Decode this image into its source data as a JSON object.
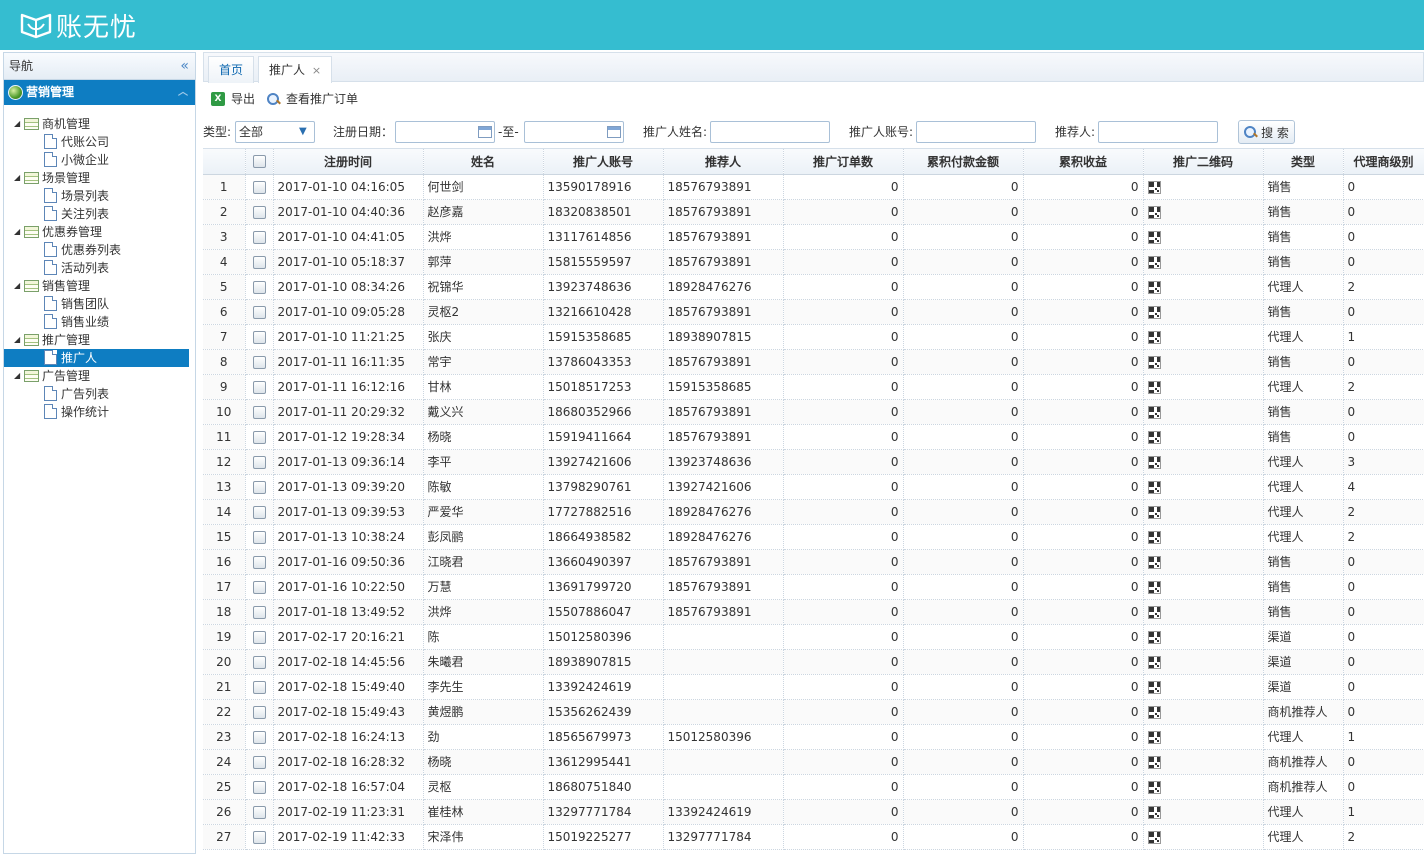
{
  "header": {
    "logo_text": "账无忧",
    "brand_color": "#35bdd0"
  },
  "nav": {
    "title": "导航",
    "collapse_icon": "«",
    "accordion_title": "营销管理",
    "accordion_icon": "︿",
    "selected_color": "#0e7dc2",
    "tree": [
      {
        "label": "商机管理",
        "children": [
          "代账公司",
          "小微企业"
        ]
      },
      {
        "label": "场景管理",
        "children": [
          "场景列表",
          "关注列表"
        ]
      },
      {
        "label": "优惠券管理",
        "children": [
          "优惠券列表",
          "活动列表"
        ]
      },
      {
        "label": "销售管理",
        "children": [
          "销售团队",
          "销售业绩"
        ]
      },
      {
        "label": "推广管理",
        "children": [
          "推广人"
        ]
      },
      {
        "label": "广告管理",
        "children": [
          "广告列表",
          "操作统计"
        ]
      }
    ],
    "selected_item": "推广人"
  },
  "tabs": [
    {
      "label": "首页"
    },
    {
      "label": "推广人",
      "close": "×"
    }
  ],
  "toolbar": {
    "export_label": "导出",
    "view_orders_label": "查看推广订单"
  },
  "filter": {
    "type_label": "类型:",
    "type_value": "全部",
    "date_label": "注册日期：",
    "date_from": "",
    "date_sep": "-至-",
    "date_to": "",
    "name_label": "推广人姓名:",
    "name_value": "",
    "account_label": "推广人账号:",
    "account_value": "",
    "referrer_label": "推荐人:",
    "referrer_value": "",
    "search_label": "搜 索"
  },
  "table": {
    "columns": [
      "",
      "",
      "注册时间",
      "姓名",
      "推广人账号",
      "推荐人",
      "推广订单数",
      "累积付款金额",
      "累积收益",
      "推广二维码",
      "类型",
      "代理商级别"
    ],
    "rows": [
      [
        "1",
        "2017-01-10 04:16:05",
        "何世剑",
        "13590178916",
        "18576793891",
        "0",
        "0",
        "0",
        "销售",
        "0"
      ],
      [
        "2",
        "2017-01-10 04:40:36",
        "赵彦嘉",
        "18320838501",
        "18576793891",
        "0",
        "0",
        "0",
        "销售",
        "0"
      ],
      [
        "3",
        "2017-01-10 04:41:05",
        "洪烨",
        "13117614856",
        "18576793891",
        "0",
        "0",
        "0",
        "销售",
        "0"
      ],
      [
        "4",
        "2017-01-10 05:18:37",
        "郭萍",
        "15815559597",
        "18576793891",
        "0",
        "0",
        "0",
        "销售",
        "0"
      ],
      [
        "5",
        "2017-01-10 08:34:26",
        "祝锦华",
        "13923748636",
        "18928476276",
        "0",
        "0",
        "0",
        "代理人",
        "2"
      ],
      [
        "6",
        "2017-01-10 09:05:28",
        "灵枢2",
        "13216610428",
        "18576793891",
        "0",
        "0",
        "0",
        "销售",
        "0"
      ],
      [
        "7",
        "2017-01-10 11:21:25",
        "张庆",
        "15915358685",
        "18938907815",
        "0",
        "0",
        "0",
        "代理人",
        "1"
      ],
      [
        "8",
        "2017-01-11 16:11:35",
        "常宇",
        "13786043353",
        "18576793891",
        "0",
        "0",
        "0",
        "销售",
        "0"
      ],
      [
        "9",
        "2017-01-11 16:12:16",
        "甘林",
        "15018517253",
        "15915358685",
        "0",
        "0",
        "0",
        "代理人",
        "2"
      ],
      [
        "10",
        "2017-01-11 20:29:32",
        "戴义兴",
        "18680352966",
        "18576793891",
        "0",
        "0",
        "0",
        "销售",
        "0"
      ],
      [
        "11",
        "2017-01-12 19:28:34",
        "杨晓",
        "15919411664",
        "18576793891",
        "0",
        "0",
        "0",
        "销售",
        "0"
      ],
      [
        "12",
        "2017-01-13 09:36:14",
        "李平",
        "13927421606",
        "13923748636",
        "0",
        "0",
        "0",
        "代理人",
        "3"
      ],
      [
        "13",
        "2017-01-13 09:39:20",
        "陈敏",
        "13798290761",
        "13927421606",
        "0",
        "0",
        "0",
        "代理人",
        "4"
      ],
      [
        "14",
        "2017-01-13 09:39:53",
        "严爱华",
        "17727882516",
        "18928476276",
        "0",
        "0",
        "0",
        "代理人",
        "2"
      ],
      [
        "15",
        "2017-01-13 10:38:24",
        "彭凤鹂",
        "18664938582",
        "18928476276",
        "0",
        "0",
        "0",
        "代理人",
        "2"
      ],
      [
        "16",
        "2017-01-16 09:50:36",
        "江晓君",
        "13660490397",
        "18576793891",
        "0",
        "0",
        "0",
        "销售",
        "0"
      ],
      [
        "17",
        "2017-01-16 10:22:50",
        "万慧",
        "13691799720",
        "18576793891",
        "0",
        "0",
        "0",
        "销售",
        "0"
      ],
      [
        "18",
        "2017-01-18 13:49:52",
        "洪烨",
        "15507886047",
        "18576793891",
        "0",
        "0",
        "0",
        "销售",
        "0"
      ],
      [
        "19",
        "2017-02-17 20:16:21",
        "陈",
        "15012580396",
        "",
        "0",
        "0",
        "0",
        "渠道",
        "0"
      ],
      [
        "20",
        "2017-02-18 14:45:56",
        "朱曦君",
        "18938907815",
        "",
        "0",
        "0",
        "0",
        "渠道",
        "0"
      ],
      [
        "21",
        "2017-02-18 15:49:40",
        "李先生",
        "13392424619",
        "",
        "0",
        "0",
        "0",
        "渠道",
        "0"
      ],
      [
        "22",
        "2017-02-18 15:49:43",
        "黄煜鹏",
        "15356262439",
        "",
        "0",
        "0",
        "0",
        "商机推荐人",
        "0"
      ],
      [
        "23",
        "2017-02-18 16:24:13",
        "劲",
        "18565679973",
        "15012580396",
        "0",
        "0",
        "0",
        "代理人",
        "1"
      ],
      [
        "24",
        "2017-02-18 16:28:32",
        "杨晓",
        "13612995441",
        "",
        "0",
        "0",
        "0",
        "商机推荐人",
        "0"
      ],
      [
        "25",
        "2017-02-18 16:57:04",
        "灵枢",
        "18680751840",
        "",
        "0",
        "0",
        "0",
        "商机推荐人",
        "0"
      ],
      [
        "26",
        "2017-02-19 11:23:31",
        "崔桂林",
        "13297771784",
        "13392424619",
        "0",
        "0",
        "0",
        "代理人",
        "1"
      ],
      [
        "27",
        "2017-02-19 11:42:33",
        "宋泽伟",
        "15019225277",
        "13297771784",
        "0",
        "0",
        "0",
        "代理人",
        "2"
      ]
    ]
  }
}
